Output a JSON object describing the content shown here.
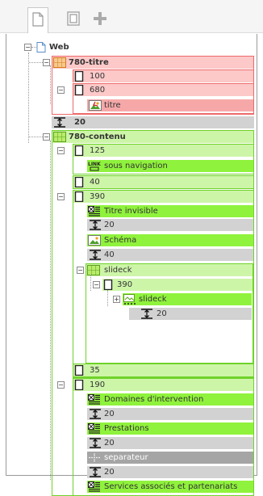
{
  "toolbar": {
    "tabs": [
      {
        "name": "page-tab",
        "icon": "page-icon",
        "active": true
      },
      {
        "name": "layout-tab",
        "icon": "layout-icon",
        "active": false
      },
      {
        "name": "add-tab",
        "icon": "plus-icon",
        "active": false
      }
    ]
  },
  "tree": {
    "root": {
      "label": "Web",
      "icon": "page-icon",
      "expander": "−"
    },
    "titre_section": {
      "label": "780-titre",
      "icon": "grid-icon",
      "expander": "−"
    },
    "titre_col_100": {
      "label": "100",
      "icon": "column-icon"
    },
    "titre_col_680": {
      "label": "680",
      "icon": "column-icon",
      "expander": "−"
    },
    "titre_image": {
      "label": "titre",
      "icon": "image-icon"
    },
    "spacer_20": {
      "label": "20",
      "icon": "spacer-icon"
    },
    "contenu_section": {
      "label": "780-contenu",
      "icon": "grid-icon",
      "expander": "−"
    },
    "col_125": {
      "label": "125",
      "icon": "column-icon",
      "expander": "−"
    },
    "sous_navigation": {
      "label": "sous navigation",
      "icon": "link-icon"
    },
    "col_40": {
      "label": "40",
      "icon": "column-icon"
    },
    "col_390": {
      "label": "390",
      "icon": "column-icon",
      "expander": "−"
    },
    "titre_invisible": {
      "label": "Titre invisible",
      "icon": "text-block-icon"
    },
    "spacer_20_a": {
      "label": "20",
      "icon": "spacer-icon"
    },
    "schema": {
      "label": "Schéma",
      "icon": "image-icon"
    },
    "spacer_40": {
      "label": "40",
      "icon": "spacer-icon"
    },
    "slideck_grid": {
      "label": "slideck",
      "icon": "grid-icon",
      "expander": "−"
    },
    "slideck_col_390": {
      "label": "390",
      "icon": "column-icon",
      "expander": "−"
    },
    "slideck_item": {
      "label": "slideck",
      "icon": "slideshow-icon",
      "expander": "+"
    },
    "slideck_spacer_20": {
      "label": "20",
      "icon": "spacer-icon"
    },
    "col_35": {
      "label": "35",
      "icon": "column-icon"
    },
    "col_190": {
      "label": "190",
      "icon": "column-icon",
      "expander": "−"
    },
    "domaines": {
      "label": "Domaines d'intervention",
      "icon": "text-block-icon"
    },
    "spacer_20_b": {
      "label": "20",
      "icon": "spacer-icon"
    },
    "prestations": {
      "label": "Prestations",
      "icon": "text-block-icon"
    },
    "spacer_20_c": {
      "label": "20",
      "icon": "spacer-icon"
    },
    "separateur": {
      "label": "separateur",
      "icon": "separator-icon"
    },
    "spacer_20_d": {
      "label": "20",
      "icon": "spacer-icon"
    },
    "services": {
      "label": "Services associés et partenariats",
      "icon": "text-block-icon"
    }
  },
  "colors": {
    "pink": "#fcc8c8",
    "pink_selected": "#f6a8a8",
    "gray": "#d2d2d2",
    "light_green": "#cdf5a8",
    "green": "#8ff23c",
    "dark_gray": "#a5a5a5",
    "red_border": "#ee6a6a",
    "green_border": "#6fd22a"
  }
}
